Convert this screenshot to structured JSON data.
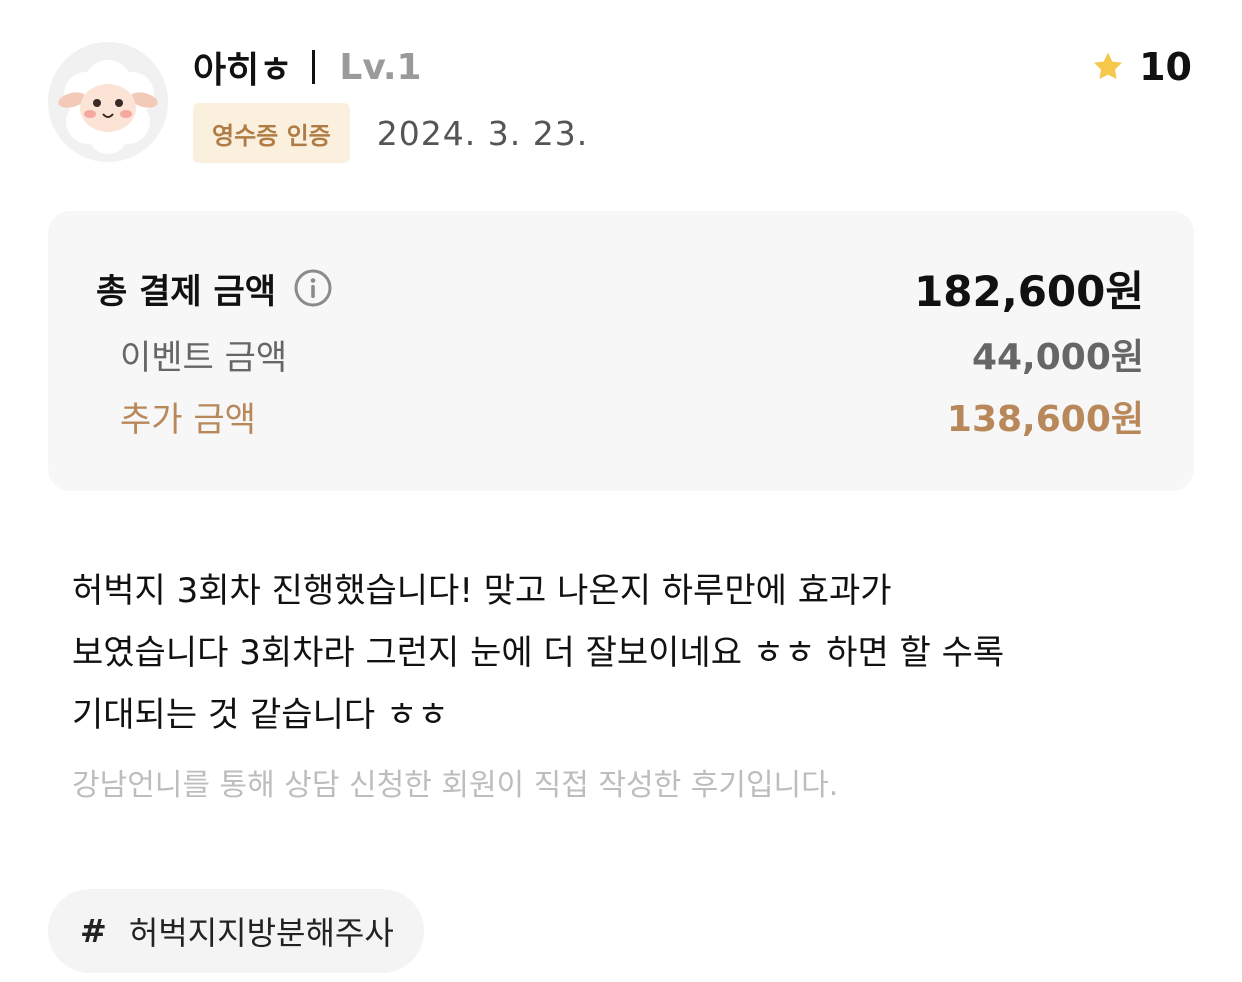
{
  "review": {
    "user": {
      "nickname": "아히ㅎ",
      "level": "Lv.1",
      "avatar_icon": "sheep-avatar-icon"
    },
    "badge": "영수증 인증",
    "date": "2024. 3. 23.",
    "rating": {
      "icon": "star-icon",
      "value": "10",
      "color": "#f5c84c"
    },
    "payment": {
      "total_label": "총 결제 금액",
      "total_amount": "182,600원",
      "info_icon": "info-icon",
      "event_label": "이벤트 금액",
      "event_amount": "44,000원",
      "extra_label": "추가 금액",
      "extra_amount": "138,600원",
      "accent_color": "#b8875a"
    },
    "body_lines": [
      "허벅지 3회차 진행했습니다! 맞고 나온지 하루만에 효과가",
      "보였습니다 3회차라 그런지 눈에 더 잘보이네요 ㅎㅎ 하면 할 수록",
      "기대되는 것 같습니다 ㅎㅎ"
    ],
    "note": "강남언니를 통해 상담 신청한 회원이 직접 작성한 후기입니다.",
    "hashtag": {
      "symbol": "#",
      "text": "허벅지지방분해주사"
    }
  }
}
